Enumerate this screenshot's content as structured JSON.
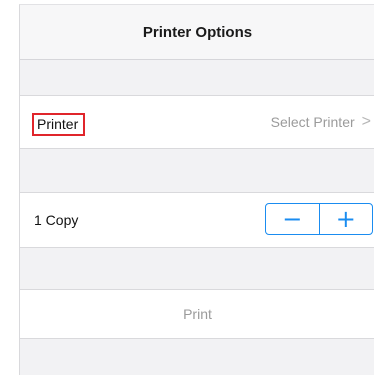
{
  "header": {
    "title": "Printer Options"
  },
  "printer_row": {
    "label": "Printer",
    "value": "Select Printer",
    "chevron": ">",
    "highlight_color": "#e0252b"
  },
  "copies_row": {
    "label": "1 Copy",
    "minus": "−",
    "plus": "+",
    "accent_color": "#1a8cf0"
  },
  "print_row": {
    "label": "Print"
  }
}
